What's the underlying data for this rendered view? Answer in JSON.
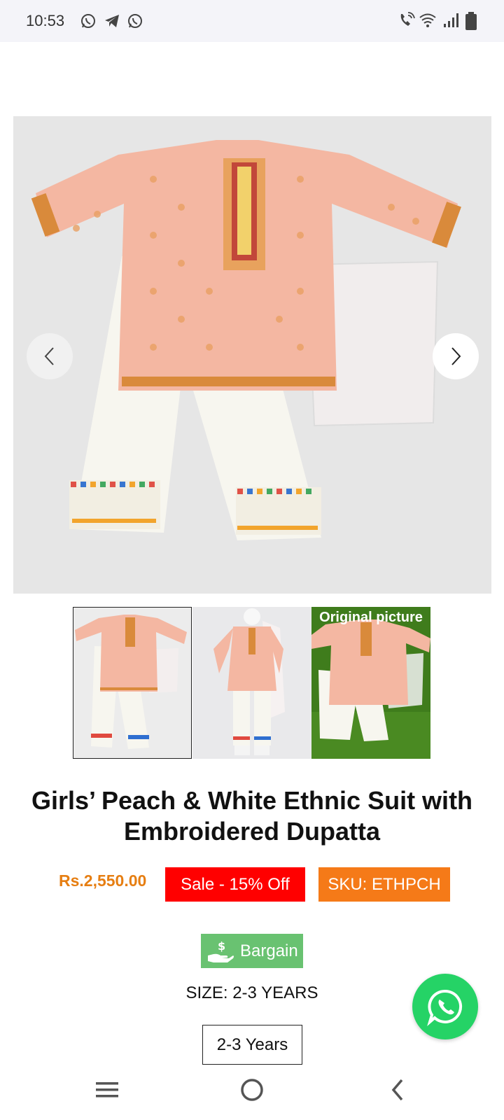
{
  "status_bar": {
    "time": "10:53",
    "left_icons": [
      "whatsapp-icon",
      "telegram-icon",
      "whatsapp-icon"
    ],
    "right_icons": [
      "wifi-calling-icon",
      "wifi-icon",
      "signal-icon",
      "battery-icon"
    ]
  },
  "gallery": {
    "main_image": "peach-white-ethnic-suit-photo",
    "prev_icon": "chevron-left-icon",
    "next_icon": "chevron-right-icon"
  },
  "thumbnails": [
    {
      "image": "suit-flatlay-photo",
      "caption": "",
      "selected": true
    },
    {
      "image": "suit-on-mannequin-photo",
      "caption": "",
      "selected": false
    },
    {
      "image": "suit-on-grass-photo",
      "caption": "Original picture",
      "selected": false
    }
  ],
  "product": {
    "title": "Girls’ Peach & White Ethnic Suit with Embroidered Dupatta",
    "price": "Rs.2,550.00",
    "sale_badge": "Sale - 15% Off",
    "sku_badge": "SKU: ETHPCH",
    "bargain_label": "Bargain",
    "size_label": "SIZE:",
    "size_value": "2-3 YEARS",
    "size_options": [
      "2-3 Years"
    ]
  },
  "fab": {
    "icon": "whatsapp-icon"
  },
  "nav_bar": {
    "icons": [
      "menu-icon",
      "home-icon",
      "back-icon"
    ]
  },
  "colors": {
    "price": "#e67e12",
    "sale_badge": "#ff0000",
    "sku_badge": "#f57a18",
    "bargain": "#69c271",
    "whatsapp": "#25d366"
  }
}
